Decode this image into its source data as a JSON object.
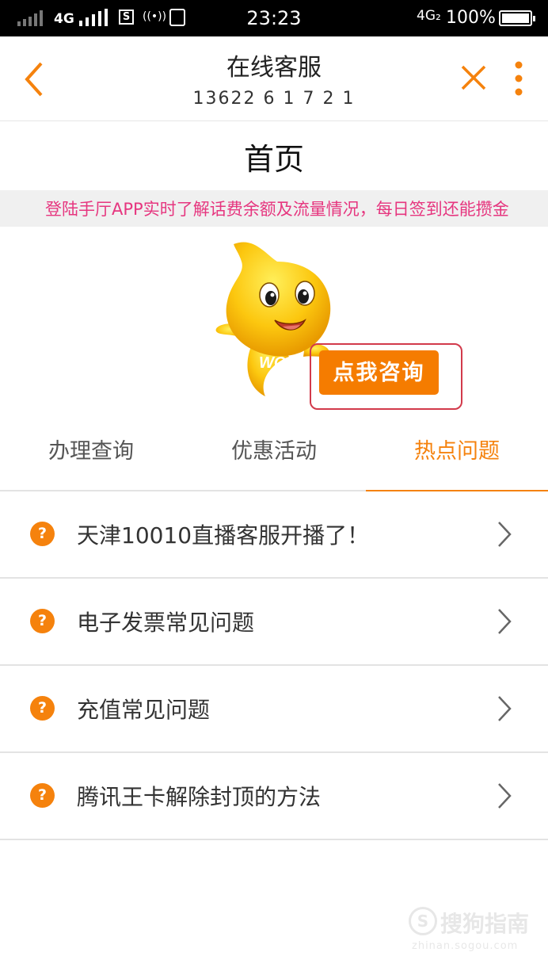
{
  "status_bar": {
    "network": "4G",
    "network2": "4G₂",
    "time": "23:23",
    "battery": "100%",
    "s_badge": "S",
    "radio_symbol": "((•))"
  },
  "header": {
    "title": "在线客服",
    "subtitle_partial": "13622 6 1 7 2 1",
    "icons": [
      "back-icon",
      "close-icon",
      "more-icon"
    ],
    "accent_color": "#f5820d"
  },
  "page_heading": "首页",
  "marquee": "登陆手厅APP实时了解话费余额及流量情况，每日签到还能攒金",
  "mascot": {
    "logo_text": "WO",
    "consult_button": "点我咨询"
  },
  "tabs": [
    {
      "label": "办理查询",
      "active": false
    },
    {
      "label": "优惠活动",
      "active": false
    },
    {
      "label": "热点问题",
      "active": true
    }
  ],
  "faq": [
    {
      "icon": "?",
      "label": "天津10010直播客服开播了！"
    },
    {
      "icon": "?",
      "label": "电子发票常见问题"
    },
    {
      "icon": "?",
      "label": "充值常见问题"
    },
    {
      "icon": "?",
      "label": "腾讯王卡解除封顶的方法"
    }
  ],
  "watermark": {
    "mark": "S",
    "text": "搜狗指南",
    "url": "zhinan.sogou.com"
  }
}
